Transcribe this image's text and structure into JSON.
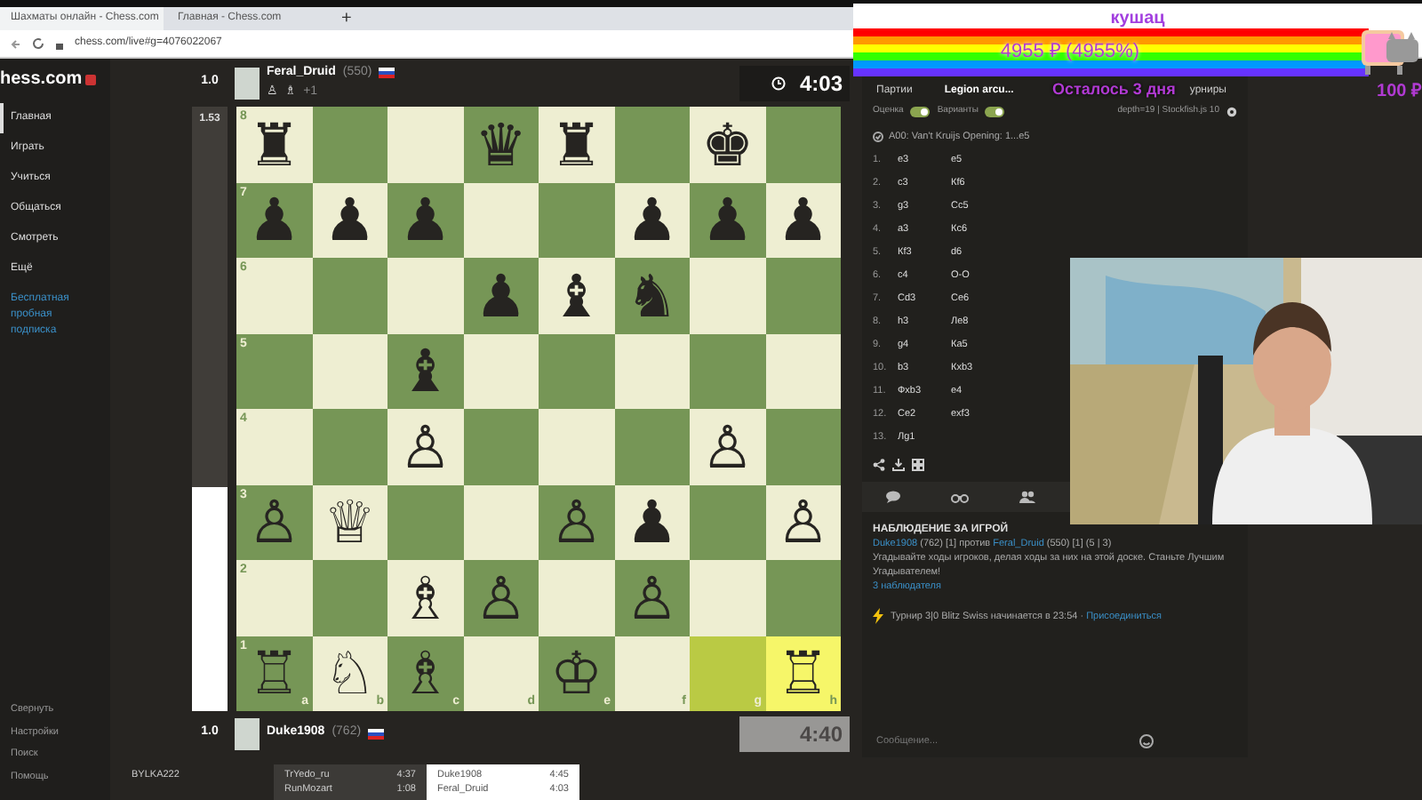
{
  "browser": {
    "tabs": [
      {
        "title": "Шахматы онлайн - Chess.com",
        "selected": true
      },
      {
        "title": "Главная - Chess.com",
        "selected": false
      }
    ],
    "new_tab": "+",
    "url": "chess.com/live#g=4076022067"
  },
  "sidebar": {
    "logo": "hess.com",
    "items": [
      {
        "label": "Главная",
        "selected": true
      },
      {
        "label": "Играть",
        "selected": false
      },
      {
        "label": "Учиться",
        "selected": false
      },
      {
        "label": "Общаться",
        "selected": false
      },
      {
        "label": "Смотреть",
        "selected": false
      },
      {
        "label": "Ещё",
        "selected": false
      }
    ],
    "promo": "Бесплатная пробная подписка",
    "bottom_items": [
      "Свернуть",
      "Настройки",
      "Поиск",
      "Помощь"
    ]
  },
  "game": {
    "top_player": {
      "score": "1.0",
      "name": "Feral_Druid",
      "rating": "(550)",
      "captured": [
        "♙",
        "♗"
      ],
      "material": "+1",
      "clock": "4:03",
      "clock_active": true
    },
    "eval_bar": {
      "label": "1.53",
      "level": 0.37
    },
    "board": {
      "ranks": [
        "8",
        "7",
        "6",
        "5",
        "4",
        "3",
        "2",
        "1"
      ],
      "files": [
        "a",
        "b",
        "c",
        "d",
        "e",
        "f",
        "g",
        "h"
      ],
      "rows": [
        [
          {
            "piece": "♜",
            "highlighted": false
          },
          {
            "highlighted": false
          },
          {
            "highlighted": false
          },
          {
            "piece": "♛",
            "highlighted": false
          },
          {
            "piece": "♜",
            "highlighted": false
          },
          {
            "highlighted": false
          },
          {
            "piece": "♚",
            "highlighted": false
          },
          {
            "highlighted": false
          }
        ],
        [
          {
            "piece": "♟",
            "highlighted": false
          },
          {
            "piece": "♟",
            "highlighted": false
          },
          {
            "piece": "♟",
            "highlighted": false
          },
          {
            "highlighted": false
          },
          {
            "highlighted": false
          },
          {
            "piece": "♟",
            "highlighted": false
          },
          {
            "piece": "♟",
            "highlighted": false
          },
          {
            "piece": "♟",
            "highlighted": false
          }
        ],
        [
          {
            "highlighted": false
          },
          {
            "highlighted": false
          },
          {
            "highlighted": false
          },
          {
            "piece": "♟",
            "highlighted": false
          },
          {
            "piece": "♝",
            "highlighted": false
          },
          {
            "piece": "♞",
            "highlighted": false
          },
          {
            "highlighted": false
          },
          {
            "highlighted": false
          }
        ],
        [
          {
            "highlighted": false
          },
          {
            "highlighted": false
          },
          {
            "piece": "♝",
            "highlighted": false
          },
          {
            "highlighted": false
          },
          {
            "highlighted": false
          },
          {
            "highlighted": false
          },
          {
            "highlighted": false
          },
          {
            "highlighted": false
          }
        ],
        [
          {
            "highlighted": false
          },
          {
            "highlighted": false
          },
          {
            "piece": "♙",
            "highlighted": false
          },
          {
            "highlighted": false
          },
          {
            "highlighted": false
          },
          {
            "highlighted": false
          },
          {
            "piece": "♙",
            "highlighted": false
          },
          {
            "highlighted": false
          }
        ],
        [
          {
            "piece": "♙",
            "highlighted": false
          },
          {
            "piece": "♕",
            "highlighted": false
          },
          {
            "highlighted": false
          },
          {
            "highlighted": false
          },
          {
            "piece": "♙",
            "highlighted": false
          },
          {
            "piece": "♟",
            "highlighted": false
          },
          {
            "highlighted": false
          },
          {
            "piece": "♙",
            "highlighted": false
          }
        ],
        [
          {
            "highlighted": false
          },
          {
            "highlighted": false
          },
          {
            "piece": "♗",
            "highlighted": false
          },
          {
            "piece": "♙",
            "highlighted": false
          },
          {
            "highlighted": false
          },
          {
            "piece": "♙",
            "highlighted": false
          },
          {
            "highlighted": false
          },
          {
            "highlighted": false
          }
        ],
        [
          {
            "piece": "♖",
            "highlighted": false
          },
          {
            "piece": "♘",
            "highlighted": false
          },
          {
            "piece": "♗",
            "highlighted": false
          },
          {
            "highlighted": false
          },
          {
            "piece": "♔",
            "highlighted": false
          },
          {
            "highlighted": false
          },
          {
            "highlighted": true
          },
          {
            "piece": "♖",
            "highlighted": true
          }
        ]
      ]
    },
    "bottom_player": {
      "score": "1.0",
      "name": "Duke1908",
      "rating": "(762)",
      "clock": "4:40",
      "clock_active": false
    }
  },
  "game_strip": [
    {
      "selected": false,
      "lines": [
        {
          "name": "BYLKA222"
        }
      ]
    },
    {
      "selected": false,
      "lines": [
        {
          "name": "TrYedo_ru",
          "time": "4:37"
        },
        {
          "name": "RunMozart",
          "time": "1:08"
        }
      ]
    },
    {
      "selected": true,
      "lines": [
        {
          "name": "Duke1908",
          "time": "4:45"
        },
        {
          "name": "Feral_Druid",
          "time": "4:03"
        }
      ]
    }
  ],
  "panel": {
    "tabs": [
      {
        "label": "Партии",
        "selected": false
      },
      {
        "label": "Legion arcu...",
        "selected": true
      },
      {
        "label": "урниры",
        "selected": false
      }
    ],
    "toggles": [
      {
        "label": "Оценка",
        "on": true
      },
      {
        "label": "Варианты",
        "on": true
      }
    ],
    "engine": "depth=19 | Stockfish.js 10",
    "opening": "A00: Van't Kruijs Opening: 1...e5",
    "moves": [
      {
        "number": "1.",
        "white": "e3",
        "black": "e5"
      },
      {
        "number": "2.",
        "white": "c3",
        "black": "Кf6"
      },
      {
        "number": "3.",
        "white": "g3",
        "black": "Cc5"
      },
      {
        "number": "4.",
        "white": "a3",
        "black": "Кc6"
      },
      {
        "number": "5.",
        "white": "Кf3",
        "black": "d6"
      },
      {
        "number": "6.",
        "white": "c4",
        "black": "O-O"
      },
      {
        "number": "7.",
        "white": "Cd3",
        "black": "Ce6"
      },
      {
        "number": "8.",
        "white": "h3",
        "black": "Лe8"
      },
      {
        "number": "9.",
        "white": "g4",
        "black": "Кa5"
      },
      {
        "number": "10.",
        "white": "b3",
        "black": "Кxb3"
      },
      {
        "number": "11.",
        "white": "Фxb3",
        "black": "e4"
      },
      {
        "number": "12.",
        "white": "Ce2",
        "black": "exf3"
      },
      {
        "number": "13.",
        "white": "Лg1"
      }
    ],
    "watch": {
      "title": "НАБЛЮДЕНИЕ ЗА ИГРОЙ",
      "summary": [
        {
          "kind": "link",
          "text": "Duke1908"
        },
        {
          "kind": "plain",
          "text": " (762) [1] против "
        },
        {
          "kind": "link",
          "text": "Feral_Druid"
        },
        {
          "kind": "plain",
          "text": " (550) [1] (5 | 3)"
        }
      ],
      "description": "Угадывайте ходы игроков, делая ходы за них на этой доске. Станьте Лучшим Угадывателем!",
      "spectators": "3 наблюдателя",
      "tournament": "Турнир 3|0 Blitz Swiss начинается в 23:54 · ",
      "join": "Присоединиться"
    },
    "message": {
      "placeholder": "Сообщение..."
    }
  },
  "donation": {
    "title": "кушац",
    "amount": "4955 ₽ (4955%)",
    "remaining": "Осталось 3 дня",
    "goal": "100 ₽"
  }
}
